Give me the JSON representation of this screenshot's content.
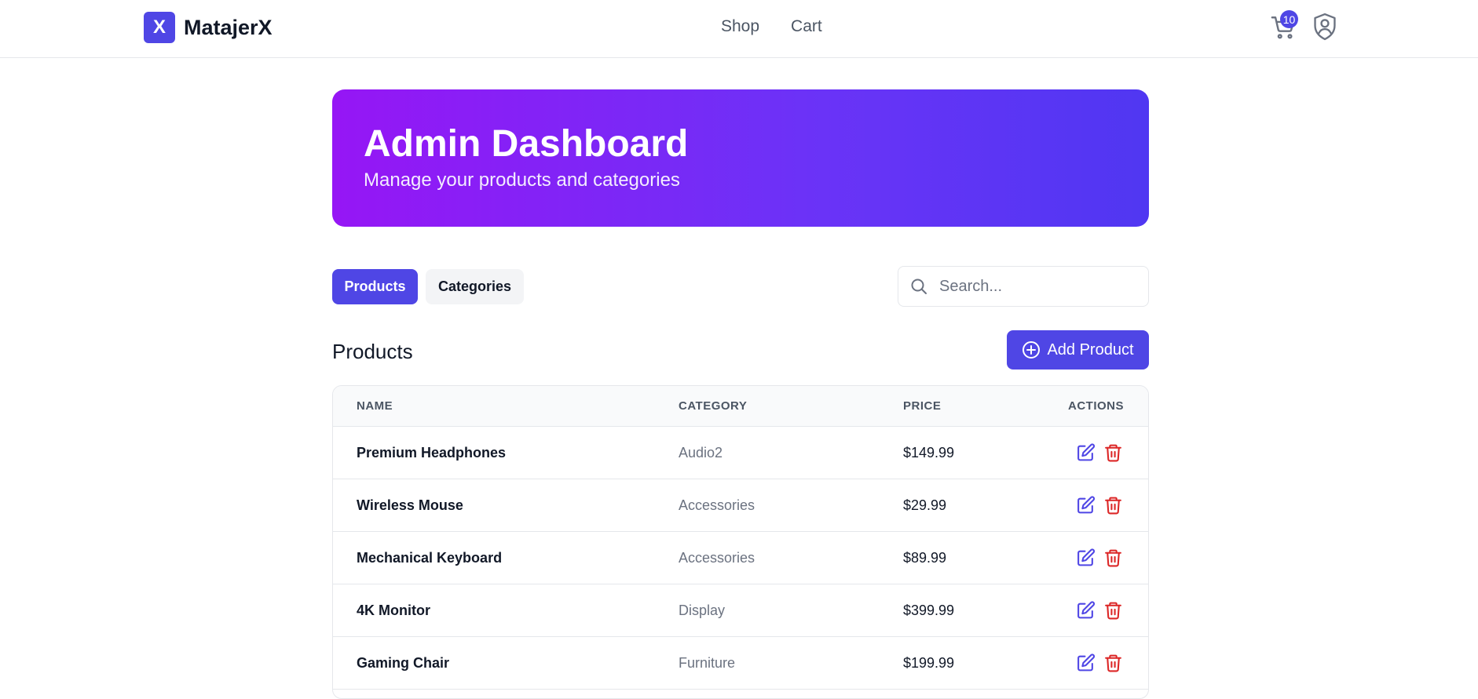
{
  "brand": {
    "mark": "X",
    "name": "MatajerX"
  },
  "nav": {
    "shop": "Shop",
    "cart": "Cart"
  },
  "cart": {
    "count": "10"
  },
  "hero": {
    "title": "Admin Dashboard",
    "subtitle": "Manage your products and categories"
  },
  "tabs": {
    "products": "Products",
    "categories": "Categories"
  },
  "search": {
    "placeholder": "Search..."
  },
  "section": {
    "title": "Products",
    "add_label": "Add Product"
  },
  "table": {
    "headers": {
      "name": "NAME",
      "category": "CATEGORY",
      "price": "PRICE",
      "actions": "ACTIONS"
    },
    "rows": [
      {
        "name": "Premium Headphones",
        "category": "Audio2",
        "price": "$149.99"
      },
      {
        "name": "Wireless Mouse",
        "category": "Accessories",
        "price": "$29.99"
      },
      {
        "name": "Mechanical Keyboard",
        "category": "Accessories",
        "price": "$89.99"
      },
      {
        "name": "4K Monitor",
        "category": "Display",
        "price": "$399.99"
      },
      {
        "name": "Gaming Chair",
        "category": "Furniture",
        "price": "$199.99"
      }
    ]
  },
  "colors": {
    "accent": "#4f46e5",
    "danger": "#dc2626",
    "gradient_start": "#9616f5",
    "gradient_end": "#5037f2"
  },
  "icons": {
    "cart": "shopping-cart-icon",
    "profile": "user-shield-icon",
    "search": "search-icon",
    "add": "plus-circle-icon",
    "edit": "edit-icon",
    "delete": "trash-icon"
  }
}
